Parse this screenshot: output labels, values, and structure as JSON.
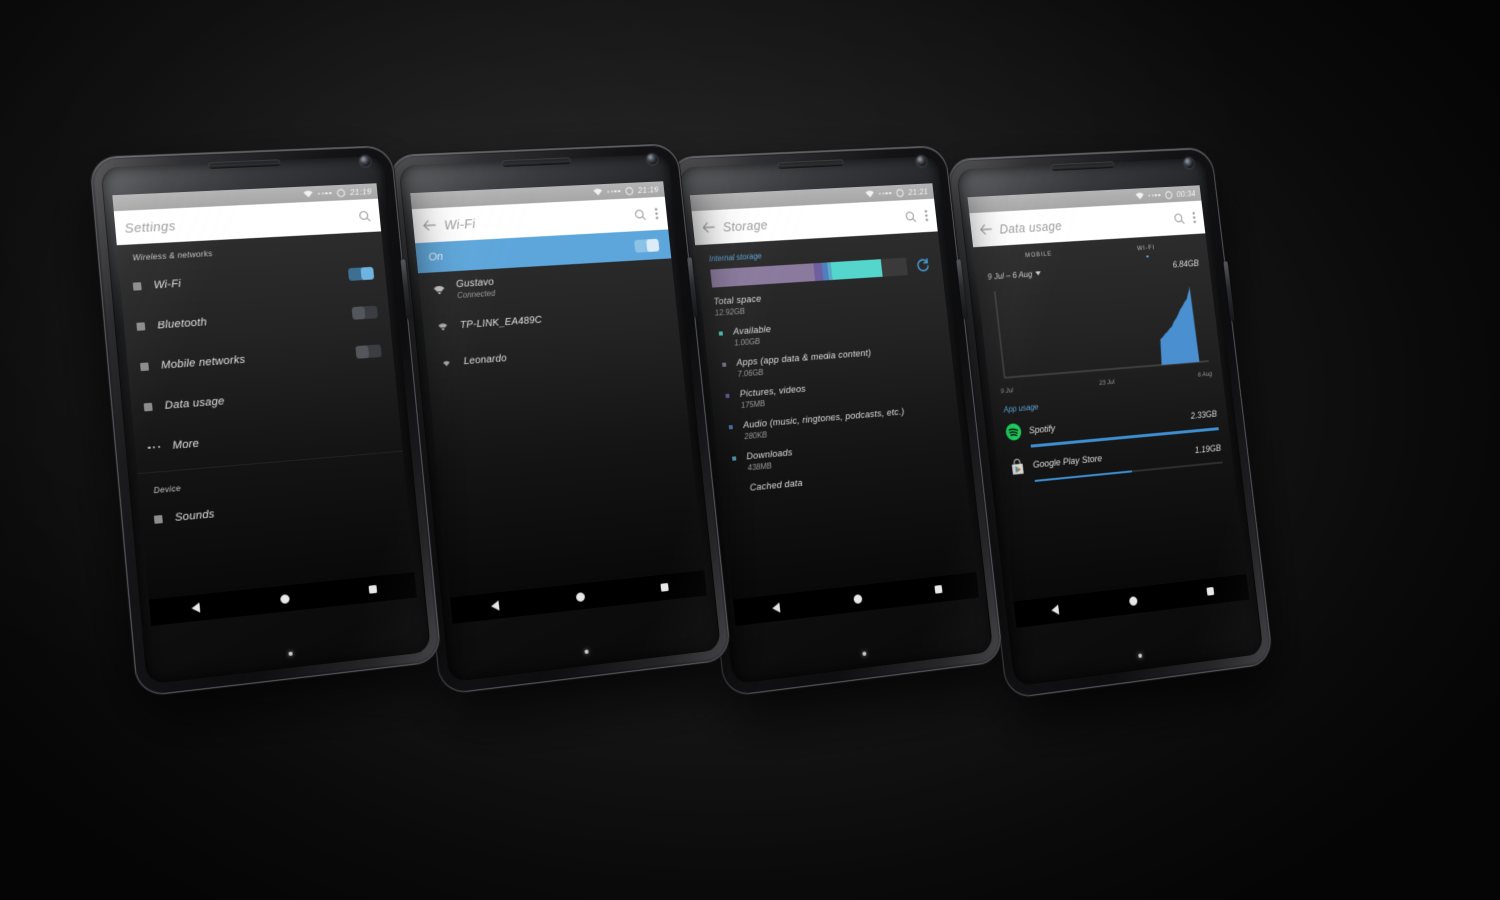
{
  "scene": {
    "background_color": "#121212",
    "accent_blue": "#5da6db",
    "device_count": 4
  },
  "phones": [
    {
      "id": "settings",
      "status_bar": {
        "time": "21:19",
        "wifi_icon": "wifi-icon",
        "signal_icon": "signal-icon",
        "battery_icon": "battery-circle-icon"
      },
      "action_bar": {
        "title": "Settings",
        "has_back": false,
        "search_icon": "search-icon",
        "overflow_icon": "overflow-menu-icon"
      },
      "sections": [
        {
          "header": "Wireless & networks",
          "rows": [
            {
              "label": "Wi-Fi",
              "icon": "wifi-settings-icon",
              "toggle": "on"
            },
            {
              "label": "Bluetooth",
              "icon": "bluetooth-icon",
              "toggle": "off"
            },
            {
              "label": "Mobile networks",
              "icon": "mobile-network-icon",
              "toggle": "off"
            },
            {
              "label": "Data usage",
              "icon": "data-usage-icon",
              "toggle": "none"
            },
            {
              "label": "More",
              "icon": "more-dots-icon",
              "toggle": "none"
            }
          ]
        },
        {
          "header": "Device",
          "rows": [
            {
              "label": "Sounds",
              "icon": "sounds-icon",
              "toggle": "none"
            }
          ]
        }
      ],
      "nav": {
        "back": "back-nav-icon",
        "home": "home-nav-icon",
        "recents": "recents-nav-icon"
      }
    },
    {
      "id": "wifi",
      "status_bar": {
        "time": "21:19"
      },
      "action_bar": {
        "title": "Wi-Fi",
        "has_back": true
      },
      "master_toggle": {
        "label": "On",
        "state": "on",
        "bar_color": "#5da6db"
      },
      "networks": [
        {
          "ssid": "Gustavo",
          "status": "Connected",
          "icon": "wifi-secured-icon",
          "strength": 4
        },
        {
          "ssid": "TP-LINK_EA489C",
          "status": "",
          "icon": "wifi-secured-icon",
          "strength": 3
        },
        {
          "ssid": "Leonardo",
          "status": "",
          "icon": "wifi-open-icon",
          "strength": 2
        }
      ]
    },
    {
      "id": "storage",
      "status_bar": {
        "time": "21:21"
      },
      "action_bar": {
        "title": "Storage",
        "has_back": true
      },
      "section_label": "Internal storage",
      "refresh_icon": "refresh-icon",
      "usage_bar": [
        {
          "name": "apps",
          "color": "#8b7a9e",
          "percent": 52
        },
        {
          "name": "pictures",
          "color": "#6f5fa0",
          "percent": 4
        },
        {
          "name": "audio",
          "color": "#4f7fbc",
          "percent": 3
        },
        {
          "name": "downloads",
          "color": "#5aa8c8",
          "percent": 2
        },
        {
          "name": "available",
          "color": "#55d6cd",
          "percent": 26
        },
        {
          "name": "free",
          "color": "#3a3a3a",
          "percent": 13
        }
      ],
      "items": [
        {
          "label": "Total space",
          "value": "12.92GB",
          "indent": false,
          "swatch": ""
        },
        {
          "label": "Available",
          "value": "1.00GB",
          "indent": true,
          "swatch": "#55d6cd"
        },
        {
          "label": "Apps (app data & media content)",
          "value": "7.06GB",
          "indent": true,
          "swatch": "#8b7a9e"
        },
        {
          "label": "Pictures, videos",
          "value": "175MB",
          "indent": true,
          "swatch": "#6f5fa0"
        },
        {
          "label": "Audio (music, ringtones, podcasts, etc.)",
          "value": "280KB",
          "indent": true,
          "swatch": "#4f7fbc"
        },
        {
          "label": "Downloads",
          "value": "438MB",
          "indent": true,
          "swatch": "#5aa8c8"
        },
        {
          "label": "Cached data",
          "value": "",
          "indent": true,
          "swatch": "#5aa8c8"
        }
      ]
    },
    {
      "id": "data_usage",
      "status_bar": {
        "time": "00:34"
      },
      "action_bar": {
        "title": "Data usage",
        "has_back": true
      },
      "tabs": [
        {
          "label": "MOBILE",
          "active": false
        },
        {
          "label": "WI-FI",
          "active": true
        }
      ],
      "range_label": "9 Jul – 6 Aug",
      "total": "6.84GB",
      "app_usage_header": "App usage",
      "apps": [
        {
          "name": "Spotify",
          "amount": "2.33GB",
          "icon": "spotify-icon",
          "percent": 100
        },
        {
          "name": "Google Play Store",
          "amount": "1.19GB",
          "icon": "google-play-icon",
          "percent": 51
        }
      ]
    }
  ],
  "chart_data": {
    "type": "area",
    "title": "Data usage",
    "xlabel": "",
    "ylabel": "",
    "legend": [
      "Wi-Fi"
    ],
    "series_color": "#4a90d0",
    "x_ticks": [
      "9 Jul",
      "23 Jul",
      "6 Aug"
    ],
    "x_range": [
      "9 Jul",
      "6 Aug"
    ],
    "ylim": [
      0,
      6.84
    ],
    "y_units": "GB",
    "total_label": "6.84GB",
    "grid": false,
    "x": [
      0,
      4,
      8,
      12,
      16,
      20,
      22,
      23,
      24,
      25,
      26,
      27,
      27.5,
      28,
      28.4,
      28.8,
      29
    ],
    "values": [
      0,
      0,
      0,
      0,
      0,
      0,
      0,
      0.05,
      1.6,
      2.4,
      3.1,
      3.9,
      4.4,
      5.0,
      5.6,
      6.4,
      6.84
    ]
  }
}
